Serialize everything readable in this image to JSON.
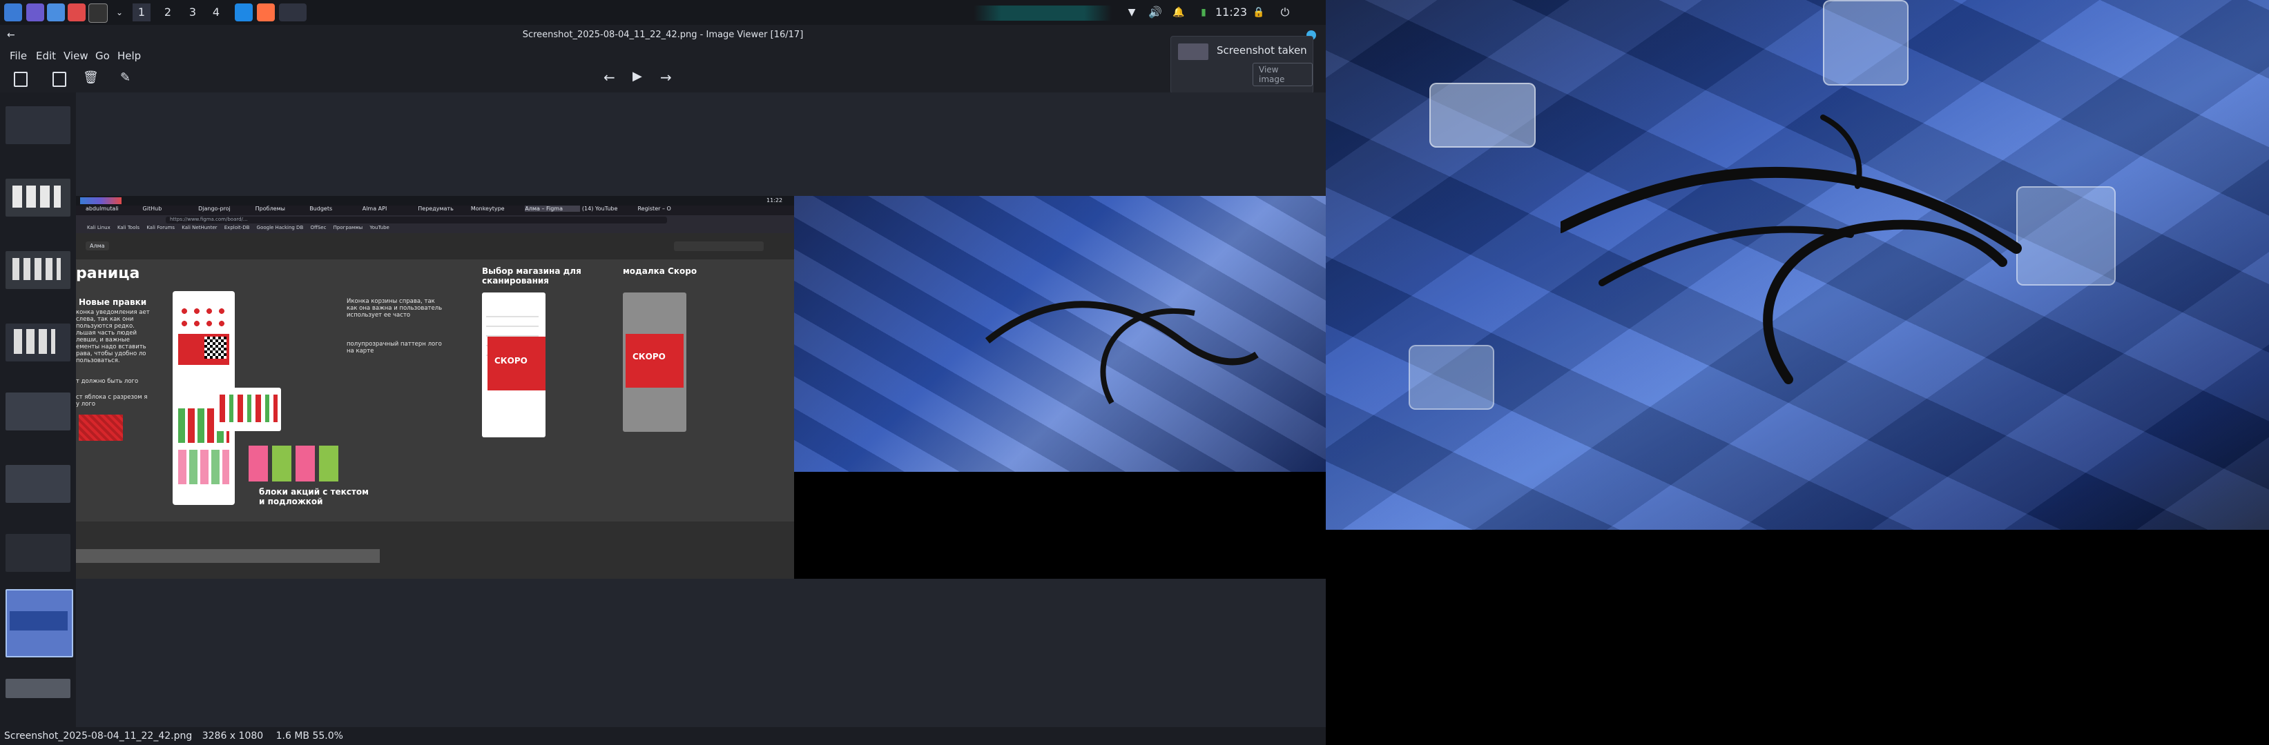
{
  "taskbar": {
    "workspaces": [
      "1",
      "2",
      "3",
      "4"
    ],
    "clock": "11:23",
    "icons": [
      "kali-menu-icon",
      "terminal-icon",
      "files-icon",
      "browser-icon",
      "editor-icon",
      "vscode-icon",
      "burp-icon"
    ]
  },
  "window": {
    "title": "Screenshot_2025-08-04_11_22_42.png - Image Viewer [16/17]"
  },
  "menu": {
    "file": "File",
    "edit": "Edit",
    "view": "View",
    "go": "Go",
    "help": "Help"
  },
  "toast": {
    "title": "Screenshot taken",
    "action": "View image"
  },
  "status": {
    "filename": "Screenshot_2025-08-04_11_22_42.png",
    "dimensions": "3286 x 1080",
    "size_zoom": "1.6 MB 55.0%"
  },
  "inner": {
    "tabs": [
      "abdulmutali",
      "GitHub",
      "Django-proj",
      "Проблемы",
      "Budgets",
      "Alma API",
      "Передумать",
      "Monkeytype",
      "Алма – Figma",
      "(14) YouTube",
      "Register – O"
    ],
    "url": "https://www.figma.com/board/...",
    "bookmarks": [
      "Kali Linux",
      "Kali Tools",
      "Kali Forums",
      "Kali NetHunter",
      "Exploit-DB",
      "Google Hacking DB",
      "OffSec",
      "Программы",
      "YouTube"
    ],
    "figma_doc": "Алма",
    "heading_page": "раница",
    "heading_new": "Новые правки",
    "text_notifications": "конка уведомления ает слева, так как они пользуются редко. льшая часть людей левши, и важные ементы надо вставить рава, чтобы удобно ло пользоваться.",
    "text_logo": "т должно быть лого",
    "text_apple": "ст яблока с разрезом я у лого",
    "note_cart": "Иконка корзины справа, так как она важна и пользователь использует ее часто",
    "note_pattern": "полупрозрачный паттерн лого на карте",
    "heading_store": "Выбор магазина для сканирования",
    "heading_modal": "модалка Скоро",
    "badge_soon": "СКОРО",
    "heading_promo": "блоки акций с текстом и подложкой",
    "inner_clock": "11:22"
  },
  "colors": {
    "accent": "#3daee9",
    "brand_red": "#d7262b",
    "wallpaper_blue": "#2d54b8"
  }
}
